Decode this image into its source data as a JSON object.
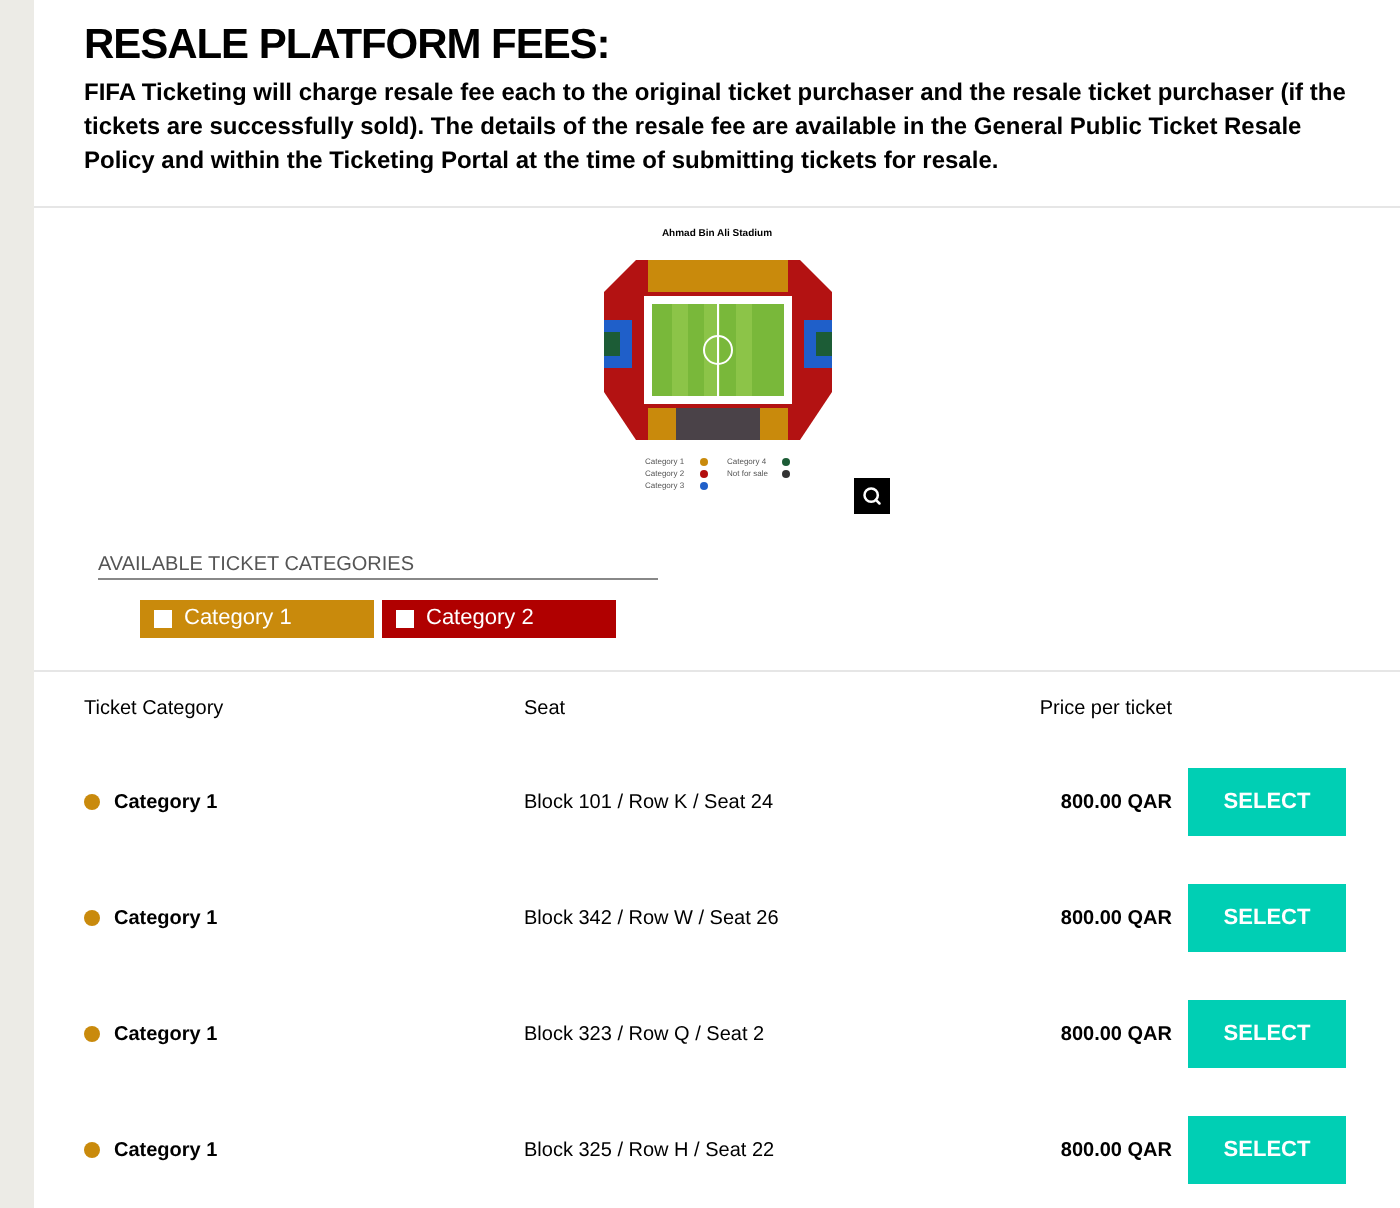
{
  "heading": "RESALE PLATFORM FEES:",
  "intro": "FIFA Ticketing will charge resale fee each to the original ticket purchaser and the resale ticket purchaser (if the tickets are successfully sold). The details of the resale fee are available in the General Public Ticket Resale Policy and within the Ticketing Portal at the time of submitting tickets for resale.",
  "seat_map": {
    "title": "Ahmad Bin Ali Stadium",
    "legend": [
      {
        "label": "Category 1",
        "color": "#c98a0c"
      },
      {
        "label": "Category 2",
        "color": "#b30d0d"
      },
      {
        "label": "Category 3",
        "color": "#1f5fc9"
      },
      {
        "label": "Category 4",
        "color": "#1c5c36"
      },
      {
        "label": "Not for sale",
        "color": "#333333"
      }
    ]
  },
  "categories": {
    "title": "AVAILABLE TICKET CATEGORIES",
    "items": [
      {
        "label": "Category 1",
        "checked": false,
        "color": "#c98a0c"
      },
      {
        "label": "Category 2",
        "checked": false,
        "color": "#b00000"
      }
    ]
  },
  "table": {
    "columns": [
      "Ticket Category",
      "Seat",
      "Price per ticket"
    ],
    "rows": [
      {
        "category": "Category 1",
        "color": "#c98a0c",
        "seat": "Block 101 / Row K / Seat 24",
        "price": "800.00 QAR",
        "action": "SELECT"
      },
      {
        "category": "Category 1",
        "color": "#c98a0c",
        "seat": "Block 342 / Row W / Seat 26",
        "price": "800.00 QAR",
        "action": "SELECT"
      },
      {
        "category": "Category 1",
        "color": "#c98a0c",
        "seat": "Block 323 / Row Q / Seat 2",
        "price": "800.00 QAR",
        "action": "SELECT"
      },
      {
        "category": "Category 1",
        "color": "#c98a0c",
        "seat": "Block 325 / Row H / Seat 22",
        "price": "800.00 QAR",
        "action": "SELECT"
      }
    ]
  }
}
